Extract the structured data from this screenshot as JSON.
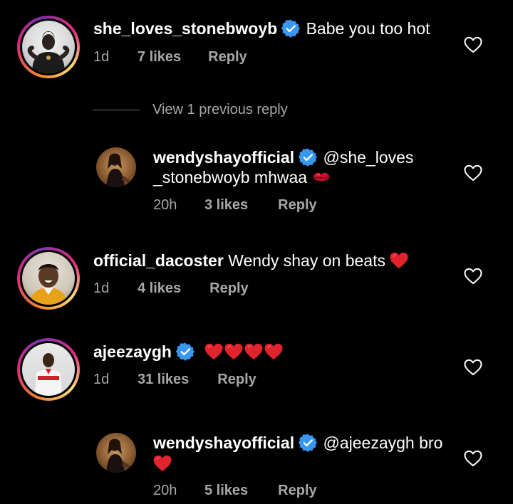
{
  "comments": [
    {
      "username": "she_loves_stonebwoyb",
      "verified": true,
      "text": "Babe you too hot",
      "time": "1d",
      "likes": "7 likes",
      "reply": "Reply"
    },
    {
      "username": "wendyshayofficial",
      "verified": true,
      "text_line1": "@she_loves",
      "text_line2": "_stonebwoyb mhwaa",
      "time": "20h",
      "likes": "3 likes",
      "reply": "Reply"
    },
    {
      "username": "official_dacoster",
      "verified": false,
      "text": "Wendy shay on beats",
      "time": "1d",
      "likes": "4 likes",
      "reply": "Reply"
    },
    {
      "username": "ajeezaygh",
      "verified": true,
      "text": "",
      "time": "1d",
      "likes": "31 likes",
      "reply": "Reply"
    },
    {
      "username": "wendyshayofficial",
      "verified": true,
      "text": "@ajeezaygh bro",
      "time": "20h",
      "likes": "5 likes",
      "reply": "Reply"
    }
  ],
  "view_replies": "View 1 previous reply",
  "colors": {
    "background": "#000000",
    "secondary_text": "#a8a8a8",
    "verified_blue": "#3897f0",
    "emoji_red": "#e0242e"
  },
  "icons": {
    "like": "heart-outline-icon",
    "verified": "verified-badge-icon",
    "emoji_heart": "red-heart-emoji",
    "emoji_kiss": "kiss-mark-emoji"
  }
}
